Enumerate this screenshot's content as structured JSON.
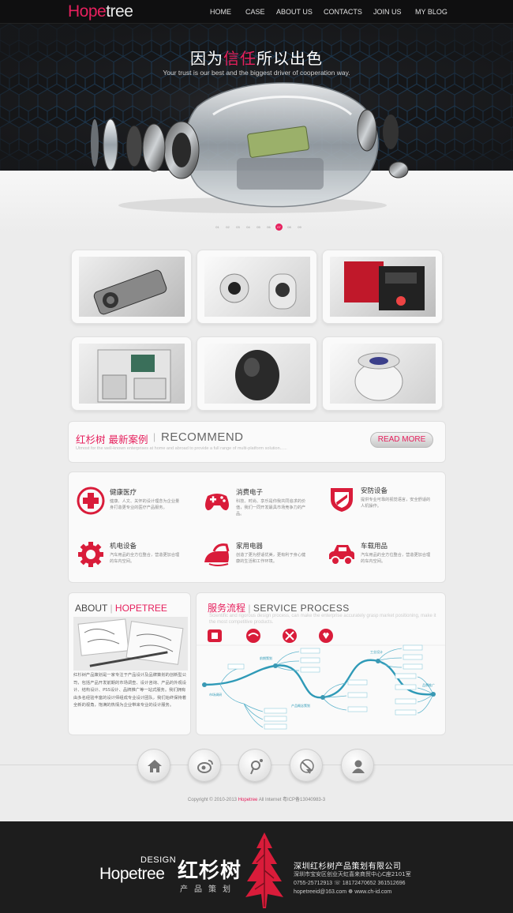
{
  "header": {
    "logo_part1": "Hope",
    "logo_part2": "tree",
    "nav": [
      "HOME",
      "CASE",
      "ABOUT US",
      "CONTACTS",
      "JOIN US",
      "MY BLOG"
    ]
  },
  "hero": {
    "title_before": "因为",
    "title_highlight": "信任",
    "title_after": "所以出色",
    "subtitle": "Your trust is our best and the biggest driver of cooperation way.",
    "slides": [
      "01",
      "02",
      "03",
      "04",
      "05",
      "06",
      "07",
      "08",
      "09"
    ],
    "active_slide": "07"
  },
  "recommend": {
    "title_cn": "红杉树 最新案例",
    "title_en": "RECOMMEND",
    "description": "Utmost for the well-known enterprises at home and abroad to provide a full range of multi-platform solution......",
    "read_more": "READ MORE"
  },
  "services": [
    {
      "icon": "medical-cross-icon",
      "title": "健康医疗",
      "desc": "健康、人文、关怀的设计理念为企业量身打造更专业的医疗产品服务。"
    },
    {
      "icon": "gamepad-icon",
      "title": "消费电子",
      "desc": "科技、时尚、享乐是你我共同追求的价值，我们一同开发最具市场竞争力的产品。"
    },
    {
      "icon": "shield-icon",
      "title": "安防设备",
      "desc": "提供专业可靠的视觉语言，安全舒适的人机操作。"
    },
    {
      "icon": "gear-icon",
      "title": "机电设备",
      "desc": "汽车用品的全方位整合，营造更加合理的车内空间。"
    },
    {
      "icon": "iron-icon",
      "title": "家用电器",
      "desc": "创造了更为舒适优美，更有利于身心健康的生活和工作环境。"
    },
    {
      "icon": "car-icon",
      "title": "车载用品",
      "desc": "汽车用品的全方位整合，营造更加合理的车内空间。"
    }
  ],
  "about": {
    "title_part1": "ABOUT",
    "title_part2": "HOPETREE",
    "text": "红杉树产品策划是一家专注于产品设计及品牌策划的创新型公司，包括产品开发前期的市场调查、设计咨询、产品的外观设计、结构设计、PSS设计、品牌推广等一站式服务。我们拥有由多名经验丰富的设计师组成专业设计团队，我们始终保持着全新的视角，饱满的热情为企业带来专业的设计服务。"
  },
  "process": {
    "title_cn": "服务流程",
    "title_en": "SERVICE PROCESS",
    "description": "Scientific and rigorous design process, can make the enterprise accurately grasp market positioning, make it the most competitive products.",
    "stages": [
      "市场调研",
      "前期策划",
      "产品概念策划",
      "工业设计",
      "品牌推广"
    ]
  },
  "social": [
    "home-icon",
    "weibo-icon",
    "tencent-weibo-icon",
    "qzone-icon",
    "user-icon"
  ],
  "copyright": {
    "before": "Copyright © 2010-2013 ",
    "brand": "Hopetree",
    "after": " All Internet     粤ICP备13040983-3"
  },
  "footer": {
    "design": "DESIGN",
    "brand": "Hopetree",
    "name_cn": "红杉树",
    "tagline": "产品策划",
    "company": "深圳红杉树产品策划有限公司",
    "address": "深圳市宝安区创业天虹喜来商贸中心C座2101室",
    "phone": "0755-25712913  ☏ 18172470652  361512696",
    "email_web": "hopetreeid@163.com    ☸ www.ch-id.com"
  },
  "colors": {
    "accent": "#e6205d",
    "dark": "#1d1d1d",
    "background": "#ececec"
  }
}
